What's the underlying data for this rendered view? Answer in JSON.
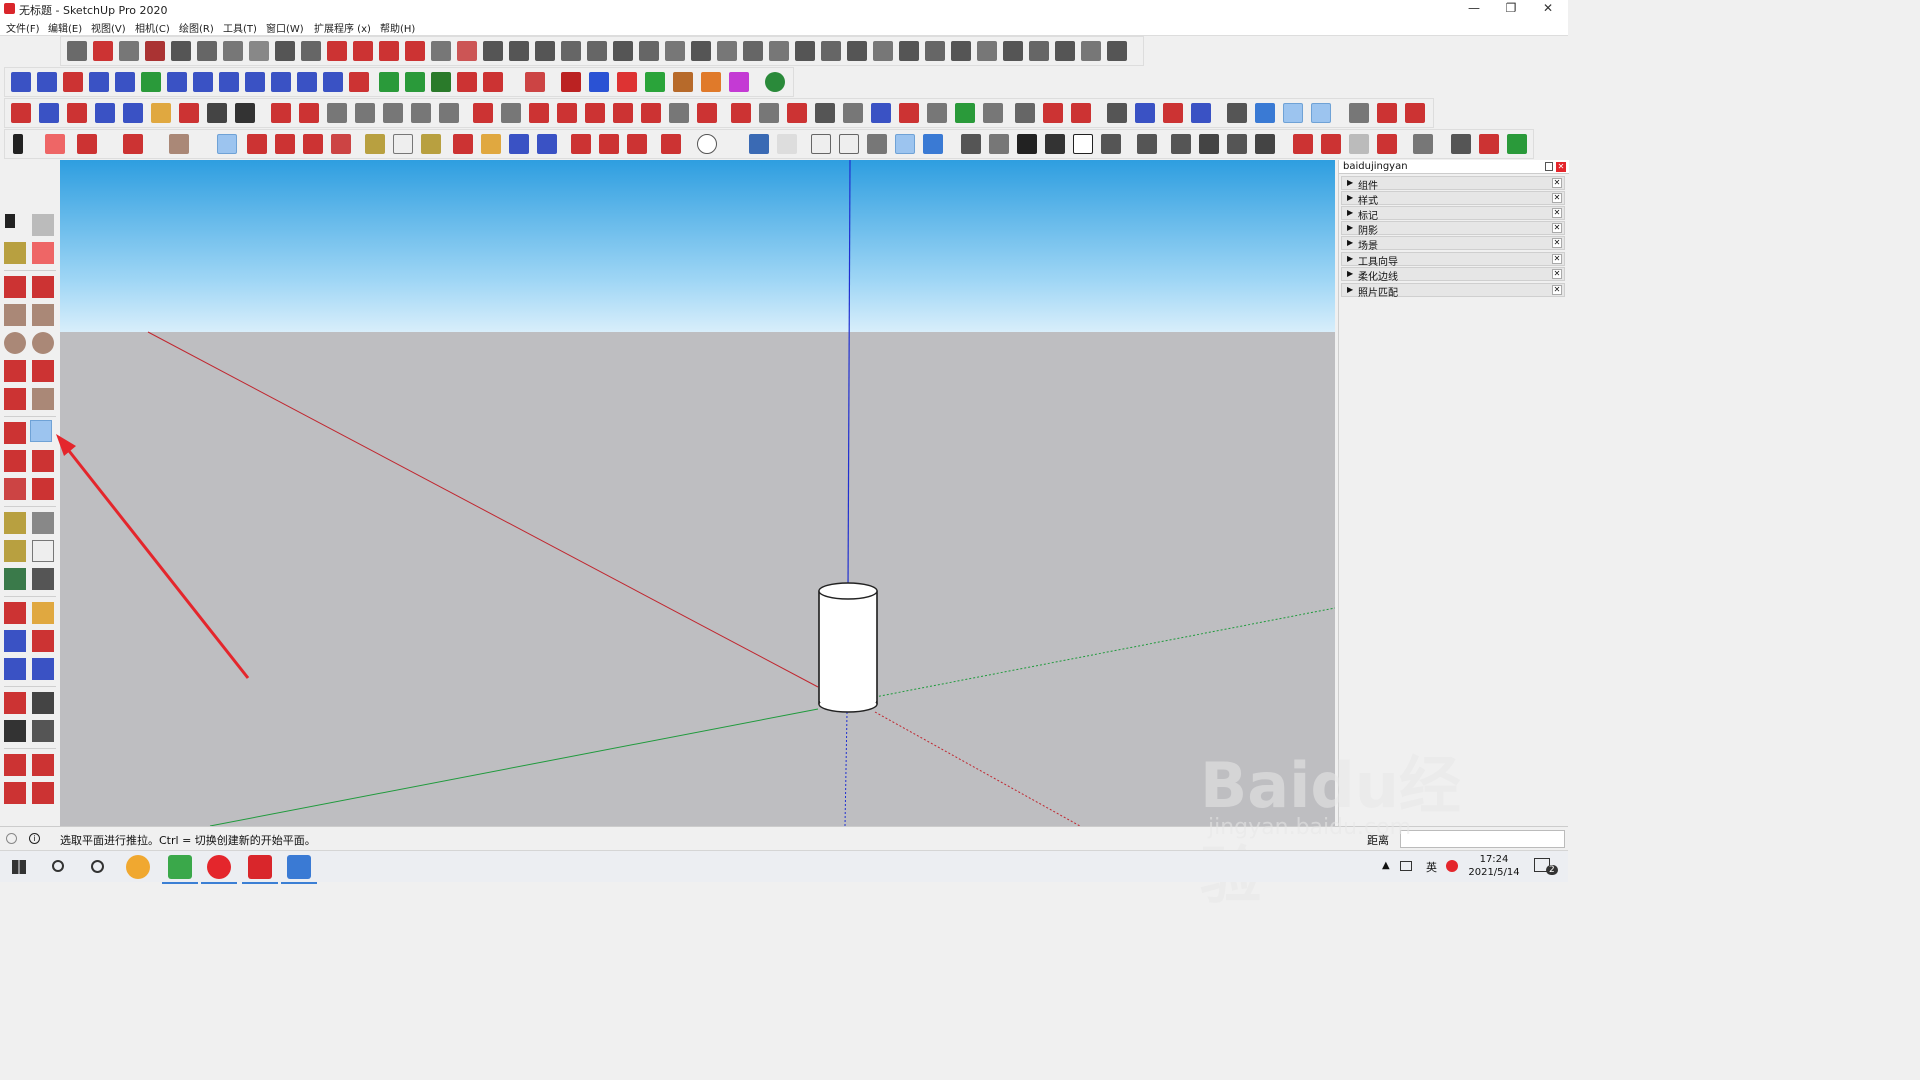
{
  "window": {
    "title": "无标题 - SketchUp Pro 2020"
  },
  "menu": [
    "文件(F)",
    "编辑(E)",
    "视图(V)",
    "相机(C)",
    "绘图(R)",
    "工具(T)",
    "窗口(W)",
    "扩展程序 (x)",
    "帮助(H)"
  ],
  "tray": {
    "title": "baidujingyan",
    "panels": [
      "组件",
      "样式",
      "标记",
      "阴影",
      "场景",
      "工具向导",
      "柔化边线",
      "照片匹配"
    ]
  },
  "status": {
    "message": "选取平面进行推拉。Ctrl = 切换创建新的开始平面。",
    "distance_label": "距离"
  },
  "taskbar": {
    "time": "17:24",
    "date": "2021/5/14",
    "ime": "英",
    "notification_count": "2"
  },
  "watermark": {
    "main": "Baidu经验",
    "sub": "jingyan.baidu.com"
  },
  "colors": {
    "accent_red": "#e4262c",
    "selected_tool": "#9cc4ef",
    "axis_red": "#c0262f",
    "axis_green": "#1f9a3c",
    "axis_blue": "#1f2fd0"
  },
  "icons": {
    "active_tool": "push-pull-icon"
  }
}
